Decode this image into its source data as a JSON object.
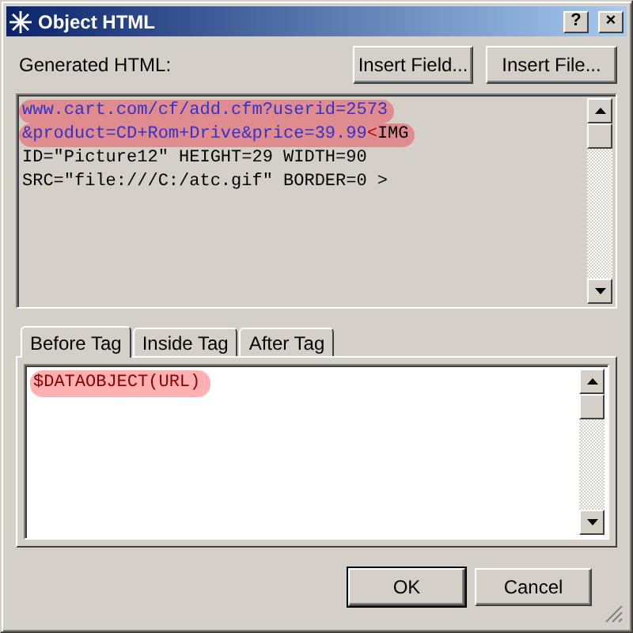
{
  "window": {
    "title": "Object HTML",
    "title_buttons": [
      "?",
      "×"
    ]
  },
  "label": "Generated HTML:",
  "insert_buttons": [
    "Insert Field...",
    "Insert File..."
  ],
  "generated_html": {
    "lines": [
      {
        "highlighted": true,
        "segments": [
          {
            "kind": "url",
            "text": "www.cart.com/cf/add.cfm?userid=2573"
          }
        ]
      },
      {
        "highlighted": true,
        "segments": [
          {
            "kind": "url",
            "text": "&product=CD+Rom+Drive&price=39.99"
          },
          {
            "kind": "bracket",
            "text": "<"
          },
          {
            "kind": "plain",
            "text": "IMG"
          }
        ]
      },
      {
        "highlighted": false,
        "segments": [
          {
            "kind": "plain",
            "text": "ID=\"Picture12\" HEIGHT=29 WIDTH=90"
          }
        ]
      },
      {
        "highlighted": false,
        "segments": [
          {
            "kind": "plain",
            "text": "SRC=\"file:///C:/atc.gif\" BORDER=0 >"
          }
        ]
      }
    ]
  },
  "tabs": [
    {
      "label": "Before Tag",
      "selected": true
    },
    {
      "label": "Inside Tag",
      "selected": false
    },
    {
      "label": "After Tag",
      "selected": false
    }
  ],
  "tag_text": {
    "text": "$DATAOBJECT(URL)",
    "highlighted": true
  },
  "buttons": [
    {
      "label": "OK",
      "default": true
    },
    {
      "label": "Cancel",
      "default": false
    }
  ]
}
